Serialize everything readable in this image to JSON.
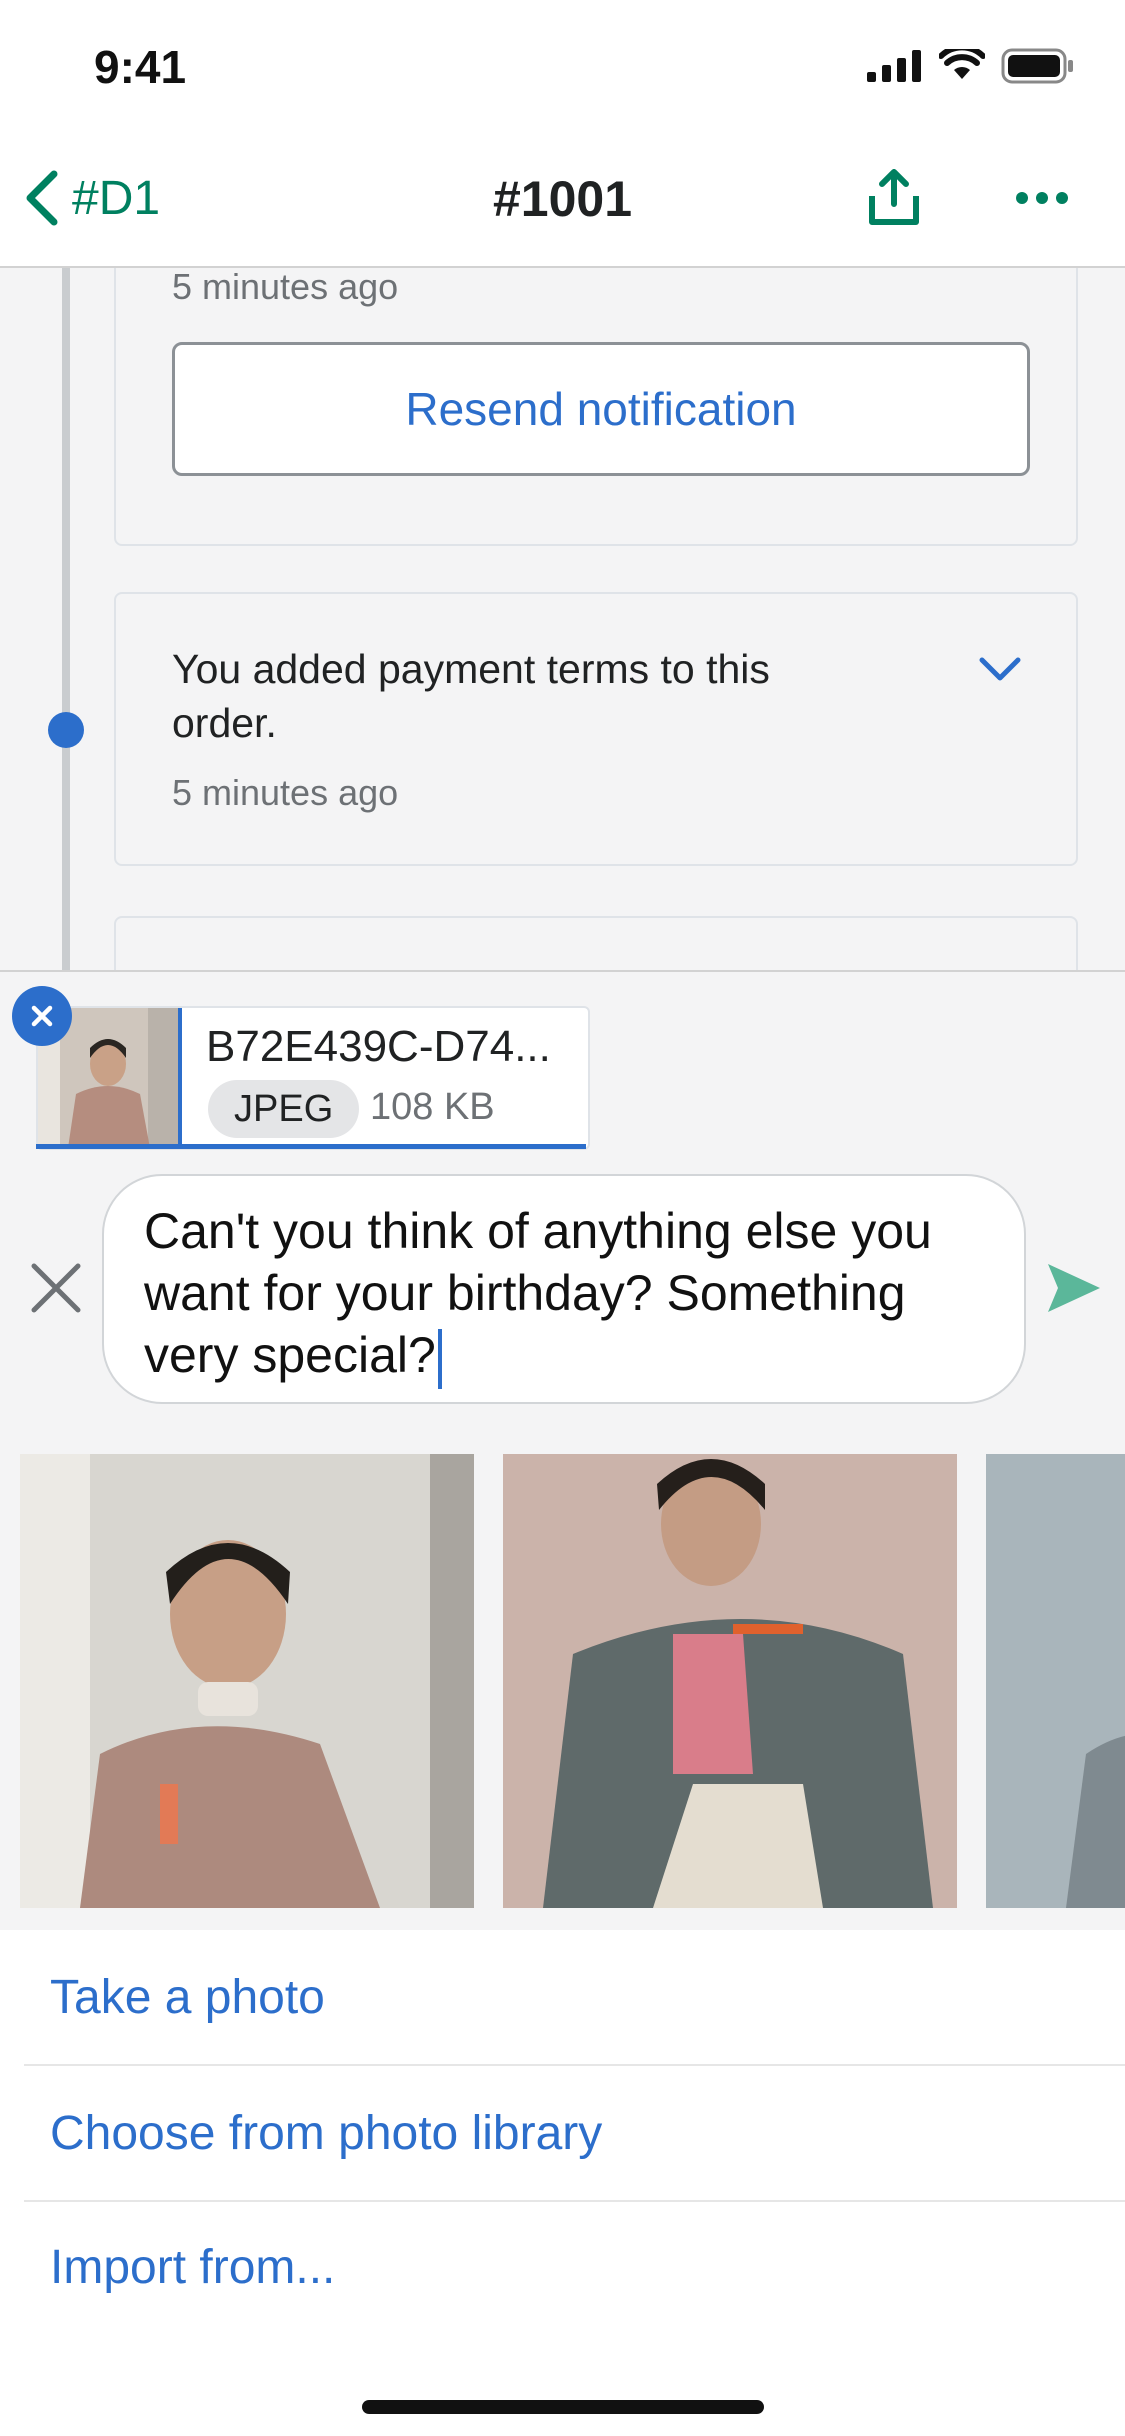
{
  "status_bar": {
    "time": "9:41"
  },
  "nav": {
    "back_label": "#D1",
    "title": "#1001"
  },
  "timeline": {
    "card1": {
      "timestamp": "5 minutes ago",
      "button_label": "Resend notification"
    },
    "card2": {
      "text": "You added payment terms to this order.",
      "timestamp": "5 minutes ago"
    }
  },
  "attachment": {
    "file_name": "B72E439C-D74...",
    "file_type": "JPEG",
    "file_size": "108 KB"
  },
  "message": {
    "text": "Can't you think of anything else you want for your birthday? Something very special?"
  },
  "sheet": {
    "options": [
      "Take a photo",
      "Choose from photo library",
      "Import from..."
    ]
  },
  "colors": {
    "brand_green": "#008060",
    "interactive_blue": "#2c6ecb",
    "send_green": "#5bb79a"
  }
}
